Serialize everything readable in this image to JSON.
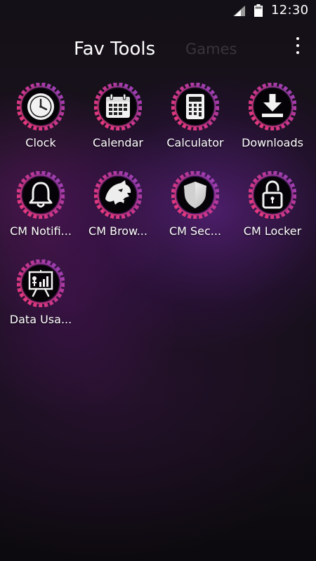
{
  "status_bar": {
    "time": "12:30",
    "signal_icon": "cell-signal-icon",
    "battery_icon": "battery-icon"
  },
  "tabs": [
    {
      "label": "Fav Tools",
      "active": true
    },
    {
      "label": "Games",
      "active": false
    }
  ],
  "menu_icon": "overflow-menu-icon",
  "theme": {
    "ring_colors": [
      "#e0357e",
      "#9b3fbf"
    ],
    "icon_bg": "#000000",
    "glyph_color": "#f2f2f2"
  },
  "apps": [
    {
      "label": "Clock",
      "icon": "clock-icon"
    },
    {
      "label": "Calendar",
      "icon": "calendar-icon"
    },
    {
      "label": "Calculator",
      "icon": "calculator-icon"
    },
    {
      "label": "Downloads",
      "icon": "download-icon"
    },
    {
      "label": "CM Notifi...",
      "icon": "bell-icon"
    },
    {
      "label": "CM Brow...",
      "icon": "panther-icon"
    },
    {
      "label": "CM Sec...",
      "icon": "shield-icon"
    },
    {
      "label": "CM Locker",
      "icon": "padlock-icon"
    },
    {
      "label": "Data Usa...",
      "icon": "chart-board-icon"
    }
  ]
}
